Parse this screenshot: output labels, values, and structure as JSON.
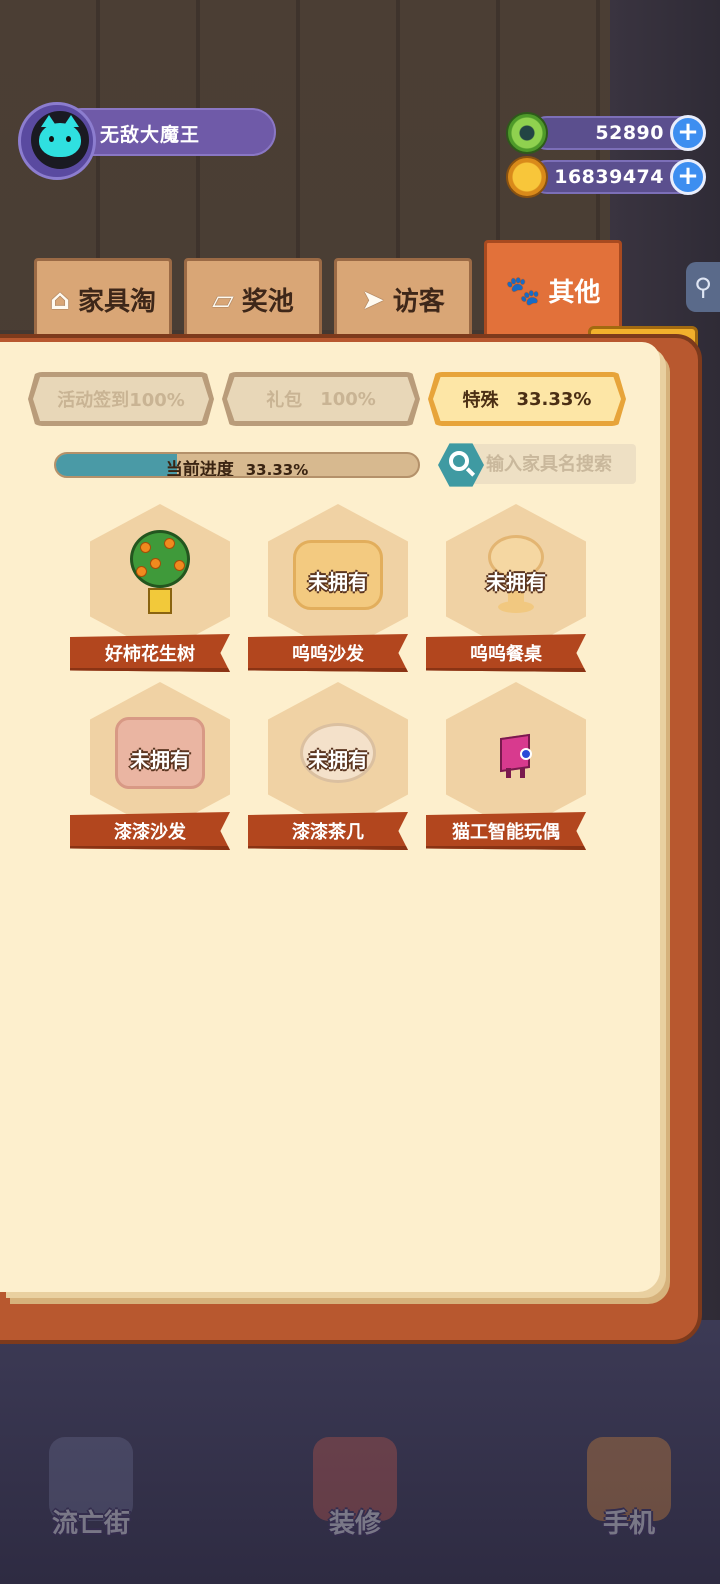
{
  "player": {
    "name": "无敌大魔王"
  },
  "currency": [
    {
      "icon": "green-donut-coin-icon",
      "amount": "52890"
    },
    {
      "icon": "gold-planet-coin-icon",
      "amount": "16839474"
    }
  ],
  "tabs": [
    {
      "icon": "house-icon",
      "label": "家具淘"
    },
    {
      "icon": "card-icon",
      "label": "奖池"
    },
    {
      "icon": "paper-plane-icon",
      "label": "访客"
    },
    {
      "icon": "paw-icon",
      "label": "其他",
      "active": true
    }
  ],
  "subtabs": [
    {
      "label": "活动签到",
      "pct": "100%"
    },
    {
      "label": "礼包",
      "pct": "100%"
    },
    {
      "label": "特殊",
      "pct": "33.33%",
      "active": true
    }
  ],
  "progress": {
    "label": "当前进度",
    "pct": "33.33%",
    "value": 0.3333
  },
  "search": {
    "placeholder": "输入家具名搜索"
  },
  "items": [
    {
      "name": "好柿花生树",
      "owned": true
    },
    {
      "name": "呜呜沙发",
      "owned": false,
      "status": "未拥有"
    },
    {
      "name": "呜呜餐桌",
      "owned": false,
      "status": "未拥有"
    },
    {
      "name": "漆漆沙发",
      "owned": false,
      "status": "未拥有"
    },
    {
      "name": "漆漆茶几",
      "owned": false,
      "status": "未拥有"
    },
    {
      "name": "猫工智能玩偶",
      "owned": true
    }
  ],
  "bottom_nav": [
    {
      "label": "流亡街"
    },
    {
      "label": "装修"
    },
    {
      "label": "手机"
    }
  ],
  "colors": {
    "active_tab": "#e2713a",
    "tab": "#d9a676",
    "page": "#fdefcd",
    "ribbon": "#b2461e",
    "progress_fill": "#4a9aa6"
  }
}
